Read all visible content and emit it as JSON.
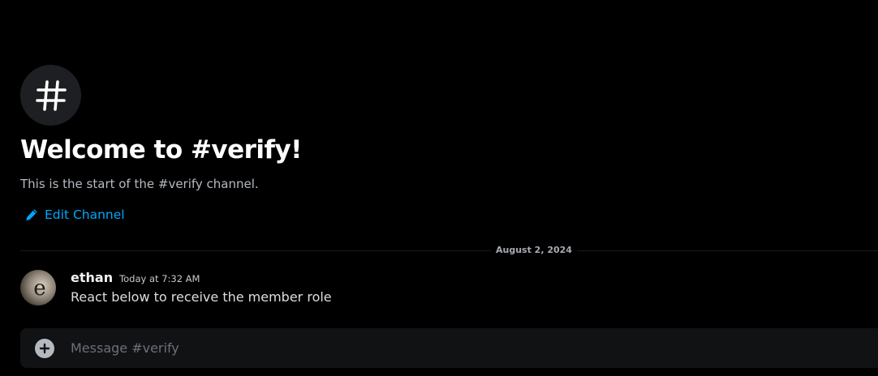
{
  "channel": {
    "icon": "hash-icon",
    "welcome_title": "Welcome to #verify!",
    "welcome_subtitle": "This is the start of the #verify channel.",
    "edit_label": "Edit Channel",
    "edit_icon": "pencil-icon"
  },
  "divider": {
    "date": "August 2, 2024"
  },
  "messages": [
    {
      "author": "ethan",
      "timestamp": "Today at 7:32 AM",
      "content": "React below to receive the member role",
      "avatar_letter": "e"
    }
  ],
  "composer": {
    "placeholder": "Message #verify",
    "attach_icon": "plus-circle-icon"
  },
  "colors": {
    "background": "#000000",
    "link": "#00a8fc",
    "composer_bg": "#111214",
    "icon_circle": "#1e1f22"
  }
}
